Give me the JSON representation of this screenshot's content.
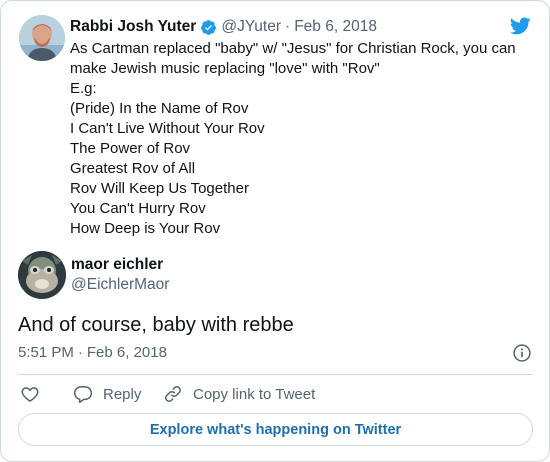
{
  "quoted_tweet": {
    "author_name": "Rabbi Josh Yuter",
    "handle": "@JYuter",
    "separator": "·",
    "date": "Feb 6, 2018",
    "lines": [
      "As Cartman replaced \"baby\" w/ \"Jesus\" for Christian Rock, you can",
      "make Jewish music  replacing \"love\" with \"Rov\"",
      "E.g:",
      "(Pride) In the Name of Rov",
      "I Can't Live Without Your Rov",
      "The Power of Rov",
      "Greatest Rov of All",
      "Rov Will Keep Us Together",
      "You Can't Hurry Rov",
      "How Deep is Your Rov"
    ]
  },
  "tweet": {
    "author_name": "maor eichler",
    "handle": "@EichlerMaor",
    "text": "And of course, baby with rebbe",
    "time": "5:51 PM",
    "separator": "·",
    "date": "Feb 6, 2018"
  },
  "actions": {
    "reply_label": "Reply",
    "copy_label": "Copy link to Tweet"
  },
  "explore_label": "Explore what's happening on Twitter",
  "icons": {
    "brand": "twitter-bird-icon",
    "verified": "verified-badge-icon",
    "info": "info-icon",
    "like": "heart-icon",
    "reply": "speech-bubble-icon",
    "copy": "link-icon"
  },
  "colors": {
    "brand_blue": "#1d9bf0",
    "link_blue": "#1d6fb0",
    "text": "#0f1419",
    "secondary_text": "#536471",
    "border": "#cfd9de"
  }
}
